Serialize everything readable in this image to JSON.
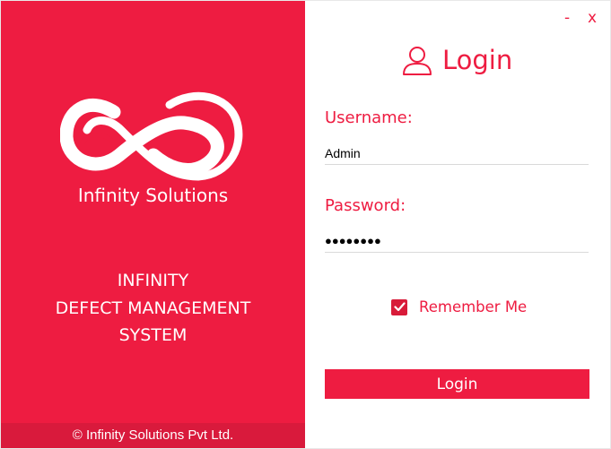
{
  "brand": {
    "company_name": "Infinity Solutions",
    "product_lines": [
      "INFINITY",
      "DEFECT MANAGEMENT",
      "SYSTEM"
    ],
    "footer": "© Infinity Solutions Pvt Ltd.",
    "color_primary": "#ee1c41",
    "color_footer": "#d91a3c",
    "logo_icon": "infinity-logo"
  },
  "window": {
    "minimize_label": "-",
    "close_label": "x"
  },
  "login": {
    "title": "Login",
    "header_icon": "user-icon",
    "username_label": "Username:",
    "username_value": "Admin",
    "password_label": "Password:",
    "password_masked": "●●●●●●●●",
    "remember_label": "Remember Me",
    "remember_checked": true,
    "button_label": "Login"
  }
}
